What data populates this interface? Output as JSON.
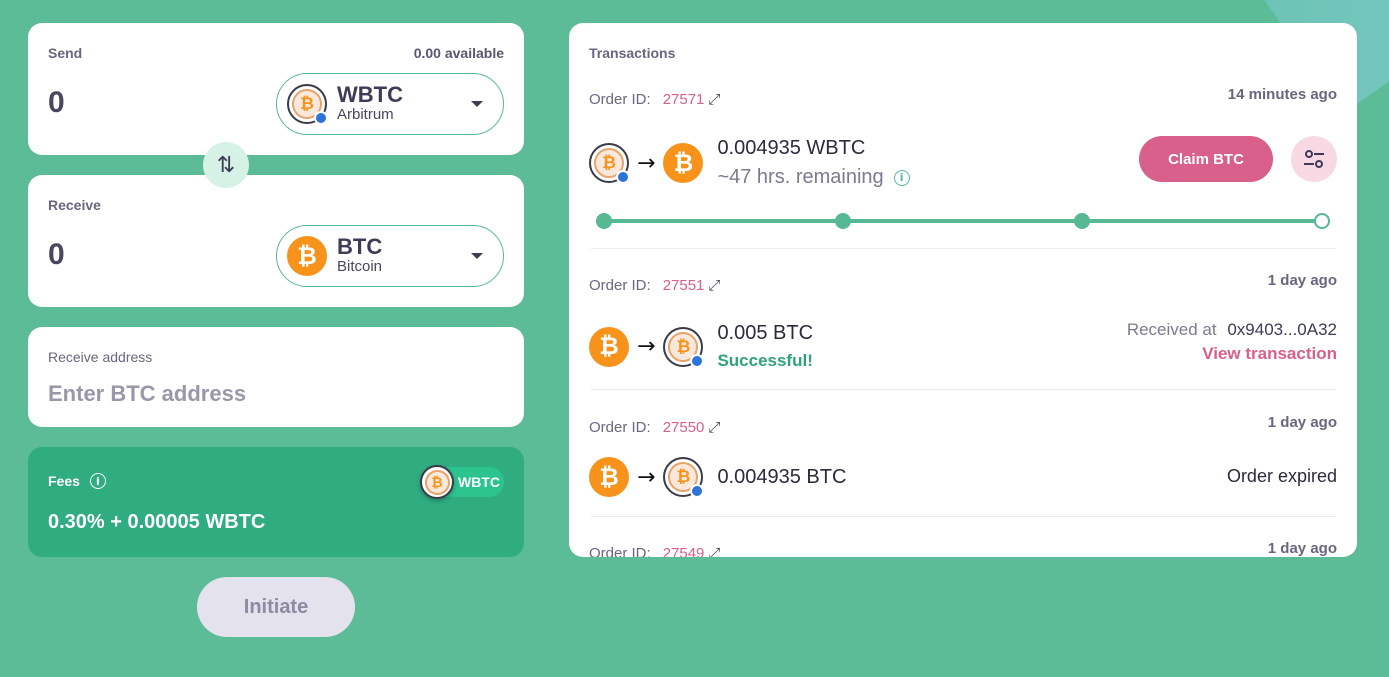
{
  "send": {
    "label": "Send",
    "available": "0.00 available",
    "amount": "0",
    "asset": {
      "symbol": "WBTC",
      "chain": "Arbitrum",
      "icon": "wbtc-icon"
    }
  },
  "receive": {
    "label": "Receive",
    "amount": "0",
    "asset": {
      "symbol": "BTC",
      "chain": "Bitcoin",
      "icon": "btc-icon"
    }
  },
  "address": {
    "label": "Receive address",
    "placeholder": "Enter BTC address"
  },
  "fees": {
    "label": "Fees",
    "value": "0.30% + 0.00005 WBTC",
    "pill": "WBTC"
  },
  "initiate_label": "Initiate",
  "transactions": {
    "title": "Transactions",
    "order_label": "Order ID:",
    "orders": [
      {
        "id": "27571",
        "time": "14 minutes ago",
        "amount": "0.004935 WBTC",
        "note": "~47 hrs. remaining",
        "action": "Claim BTC",
        "progress_steps": 4
      },
      {
        "id": "27551",
        "time": "1 day ago",
        "amount": "0.005 BTC",
        "status": "Successful!",
        "received_label": "Received at",
        "received_addr": "0x9403...0A32",
        "link": "View transaction"
      },
      {
        "id": "27550",
        "time": "1 day ago",
        "amount": "0.004935 BTC",
        "status": "Order expired"
      },
      {
        "id": "27549",
        "time": "1 day ago"
      }
    ]
  },
  "colors": {
    "background": "#5cbc98",
    "accent": "#d9608a",
    "green": "#2fac80",
    "btc": "#f7931a"
  }
}
